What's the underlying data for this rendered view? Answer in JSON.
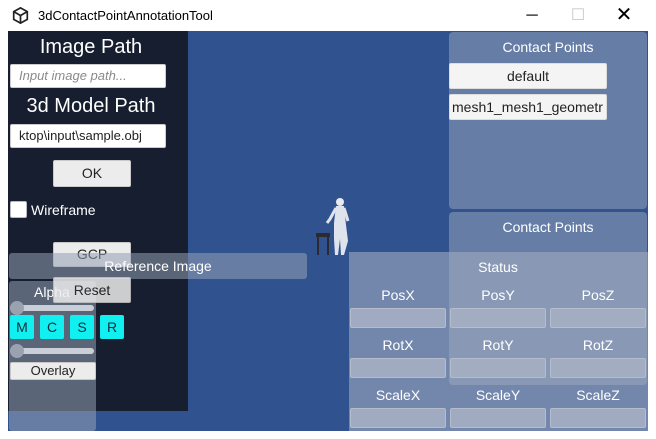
{
  "window": {
    "title": "3dContactPointAnnotationTool"
  },
  "left": {
    "image_path_label": "Image Path",
    "image_path_placeholder": "Input image path...",
    "model_path_label": "3d Model Path",
    "model_path_value": "ktop\\input\\sample.obj",
    "ok_label": "OK",
    "wireframe_label": "Wireframe",
    "gcp_label": "GCP",
    "reset_label": "Reset",
    "alpha_label": "Alpha",
    "overlay_label": "Overlay",
    "mode_buttons": [
      "M",
      "C",
      "S",
      "R"
    ],
    "reference_image_label": "Reference Image"
  },
  "right": {
    "contact_points_title": "Contact Points",
    "items": [
      "default",
      "mesh1_mesh1_geometr"
    ],
    "contact_points_title2": "Contact Points",
    "status_label": "Status",
    "transform_labels": [
      "PosX",
      "PosY",
      "PosZ",
      "RotX",
      "RotY",
      "RotZ",
      "ScaleX",
      "ScaleY",
      "ScaleZ"
    ]
  }
}
